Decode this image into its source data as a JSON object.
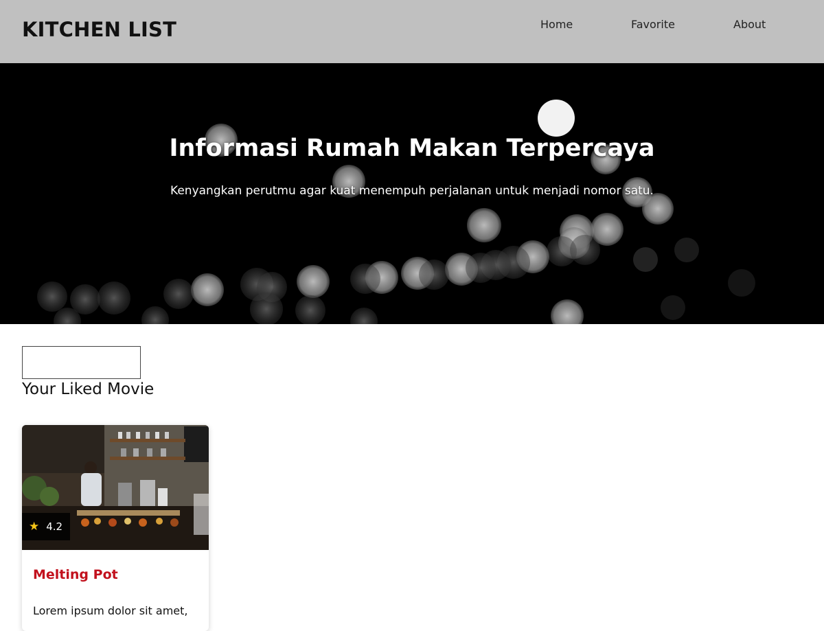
{
  "header": {
    "brand": "KITCHEN LIST",
    "nav": [
      {
        "label": "Home"
      },
      {
        "label": "Favorite"
      },
      {
        "label": "About"
      }
    ]
  },
  "hero": {
    "title": "Informasi Rumah Makan Terpercaya",
    "subtitle": "Kenyangkan perutmu agar kuat menempuh perjalanan untuk menjadi nomor satu."
  },
  "search": {
    "value": "",
    "placeholder": ""
  },
  "section": {
    "title": "Your Liked Movie"
  },
  "cards": [
    {
      "name": "Melting Pot",
      "rating": "4.2",
      "star_icon": "star-icon",
      "description": "Lorem ipsum dolor sit amet,"
    }
  ],
  "colors": {
    "header_bg": "#c0c0c0",
    "hero_bg": "#000000",
    "card_title": "#c2111d",
    "star": "#f5c518"
  }
}
